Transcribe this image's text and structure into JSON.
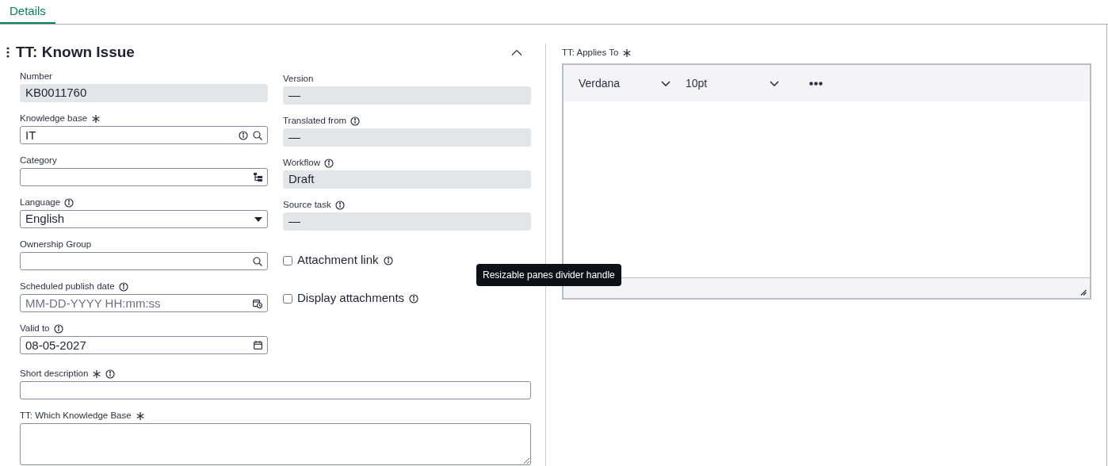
{
  "tabs": [
    {
      "label": "Details",
      "selected": true
    }
  ],
  "section": {
    "title": "TT: Known Issue",
    "expanded": true
  },
  "left_fields": [
    {
      "label": "Number",
      "kind": "readonly",
      "value": "KB0011760",
      "required": false,
      "info": false
    },
    {
      "label": "Knowledge base",
      "kind": "reference",
      "value": "IT",
      "required": true,
      "info": false,
      "preview": true
    },
    {
      "label": "Category",
      "kind": "tree",
      "required": false,
      "info": false
    },
    {
      "label": "Language",
      "kind": "select",
      "value": "English",
      "required": false,
      "info": true
    },
    {
      "label": "Ownership Group",
      "kind": "reference",
      "required": false,
      "info": false,
      "preview": false
    },
    {
      "label": "Scheduled publish date",
      "kind": "datetime",
      "placeholder": "MM-DD-YYYY HH:mm:ss",
      "required": false,
      "info": true
    },
    {
      "label": "Valid to",
      "kind": "date",
      "value": "08-05-2027",
      "required": false,
      "info": true
    }
  ],
  "right_fields": [
    {
      "label": "Version",
      "kind": "readonly",
      "value": "—",
      "required": false,
      "info": false
    },
    {
      "label": "Translated from",
      "kind": "readonly",
      "value": "—",
      "required": false,
      "info": true
    },
    {
      "label": "Workflow",
      "kind": "readonly",
      "value": "Draft",
      "required": false,
      "info": true
    },
    {
      "label": "Source task",
      "kind": "readonly",
      "value": "—",
      "required": false,
      "info": true
    },
    {
      "label": "Attachment link",
      "kind": "checkbox",
      "checked": false,
      "info": true
    },
    {
      "label": "Display attachments",
      "kind": "checkbox",
      "checked": false,
      "info": true
    }
  ],
  "wide_fields": [
    {
      "label": "Short description",
      "kind": "text",
      "required": true,
      "info": true
    },
    {
      "label": "TT: Which Knowledge Base",
      "kind": "textarea",
      "required": true,
      "info": false
    }
  ],
  "editor": {
    "label": "TT: Applies To",
    "required": true,
    "font": "Verdana",
    "size": "10pt"
  },
  "tooltip": "Resizable panes divider handle"
}
